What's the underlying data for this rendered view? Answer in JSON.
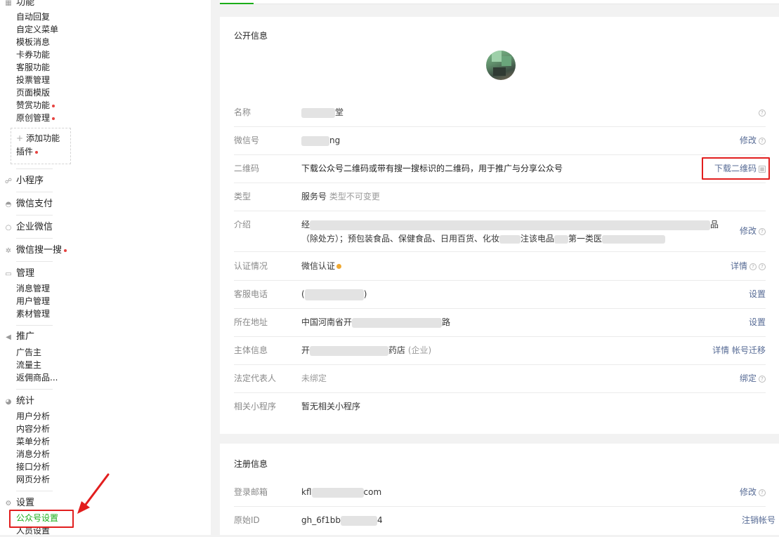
{
  "sidebar": {
    "function_header": "功能",
    "function_items": [
      "自动回复",
      "自定义菜单",
      "模板消息",
      "卡券功能",
      "客服功能",
      "投票管理",
      "页面模版",
      "赞赏功能",
      "原创管理"
    ],
    "add_function": "添加功能",
    "plugin": "插件",
    "mini_program": "小程序",
    "wechat_pay": "微信支付",
    "enterprise_wechat": "企业微信",
    "wechat_search": "微信搜一搜",
    "manage_header": "管理",
    "manage_items": [
      "消息管理",
      "用户管理",
      "素材管理"
    ],
    "promo_header": "推广",
    "promo_items": [
      "广告主",
      "流量主",
      "返佣商品..."
    ],
    "stats_header": "统计",
    "stats_items": [
      "用户分析",
      "内容分析",
      "菜单分析",
      "消息分析",
      "接口分析",
      "网页分析"
    ],
    "settings_header": "设置",
    "settings_items": [
      "公众号设置",
      "人员设置"
    ]
  },
  "public_info": {
    "title": "公开信息",
    "name": {
      "label": "名称",
      "value": "堂"
    },
    "wechat_id": {
      "label": "微信号",
      "value": "ng",
      "action": "修改"
    },
    "qrcode": {
      "label": "二维码",
      "value": "下载公众号二维码或带有搜一搜标识的二维码，用于推广与分享公众号",
      "action": "下载二维码"
    },
    "type": {
      "label": "类型",
      "value": "服务号",
      "note": "类型不可变更"
    },
    "intro": {
      "label": "介绍",
      "line1": "经",
      "line1_end": "品",
      "line2": "（除处方）；预包装食品、保健食品、日用百货、化妆",
      "line2_mid": "注该电品",
      "line2_end": "第一类医",
      "action": "修改"
    },
    "verify": {
      "label": "认证情况",
      "value": "微信认证",
      "action": "详情"
    },
    "phone": {
      "label": "客服电话",
      "value": "(",
      "value_end": ")",
      "action": "设置"
    },
    "address": {
      "label": "所在地址",
      "value": "中国河南省开",
      "value_end": "路",
      "action": "设置"
    },
    "subject": {
      "label": "主体信息",
      "value": "开",
      "value_mid": "药店",
      "value_note": "(企业)",
      "action1": "详情",
      "action2": "帐号迁移"
    },
    "legal": {
      "label": "法定代表人",
      "value": "未绑定",
      "action": "绑定"
    },
    "related": {
      "label": "相关小程序",
      "value": "暂无相关小程序"
    }
  },
  "register_info": {
    "title": "注册信息",
    "email": {
      "label": "登录邮箱",
      "value": "kfl",
      "value_end": "com",
      "action": "修改"
    },
    "origin_id": {
      "label": "原始ID",
      "value": "gh_6f1bb",
      "value_end": "4",
      "action": "注销帐号"
    }
  },
  "colors": {
    "accent": "#1aad19",
    "link": "#576b95",
    "highlight": "#e21e1e",
    "dot": "#e64340"
  }
}
